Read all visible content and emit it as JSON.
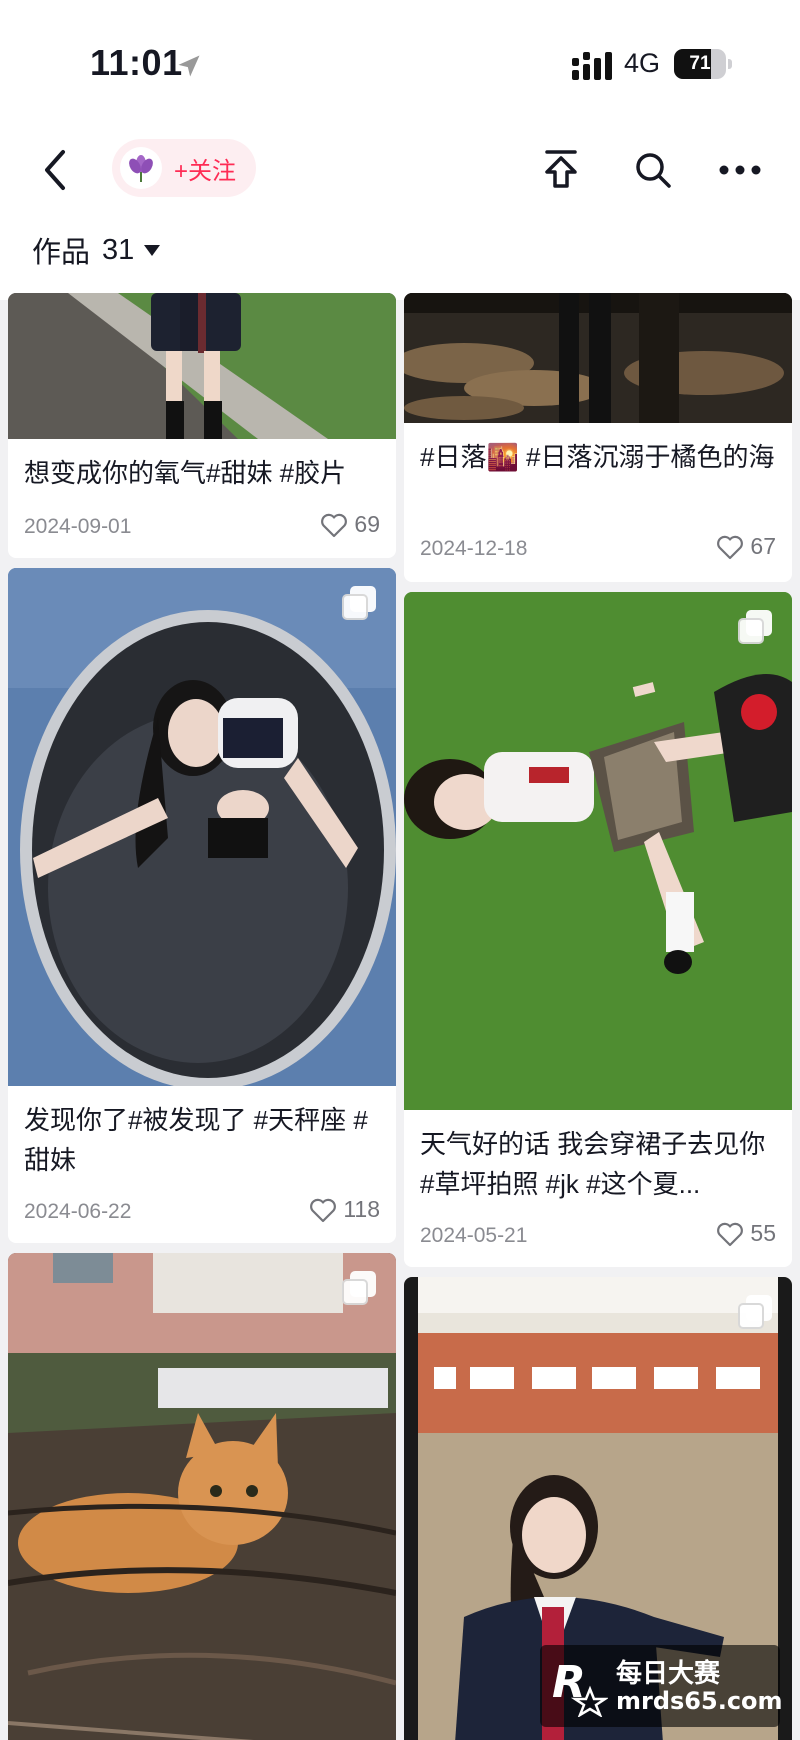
{
  "status_bar": {
    "time": "11:01",
    "network": "4G",
    "battery": "71",
    "battery_level": 0.71
  },
  "header": {
    "follow_label": "+关注",
    "icons": [
      "back-icon",
      "pin-to-top-icon",
      "search-icon",
      "more-icon"
    ]
  },
  "works": {
    "label": "作品",
    "count": "31"
  },
  "colors": {
    "accent": "#fe2c55",
    "follow_bg": "#fdeef1",
    "page_bg": "#f1f1f3"
  },
  "columns": {
    "left": [
      {
        "caption": "想变成你的氧气#甜妹 #胶片",
        "date": "2024-09-01",
        "likes": "69",
        "multi_image": false
      },
      {
        "caption": "发现你了#被发现了 #天秤座 #甜妹",
        "date": "2024-06-22",
        "likes": "118",
        "multi_image": true
      },
      {
        "caption": "",
        "date": "",
        "likes": "",
        "multi_image": true
      }
    ],
    "right": [
      {
        "caption": "#日落🌇 #日落沉溺于橘色的海",
        "date": "2024-12-18",
        "likes": "67",
        "multi_image": false
      },
      {
        "caption": "天气好的话 我会穿裙子去见你#草坪拍照 #jk #这个夏...",
        "date": "2024-05-21",
        "likes": "55",
        "multi_image": true
      },
      {
        "caption": "",
        "date": "",
        "likes": "",
        "multi_image": true
      }
    ]
  },
  "watermark": {
    "title": "每日大赛",
    "site": "mrds65.com"
  }
}
